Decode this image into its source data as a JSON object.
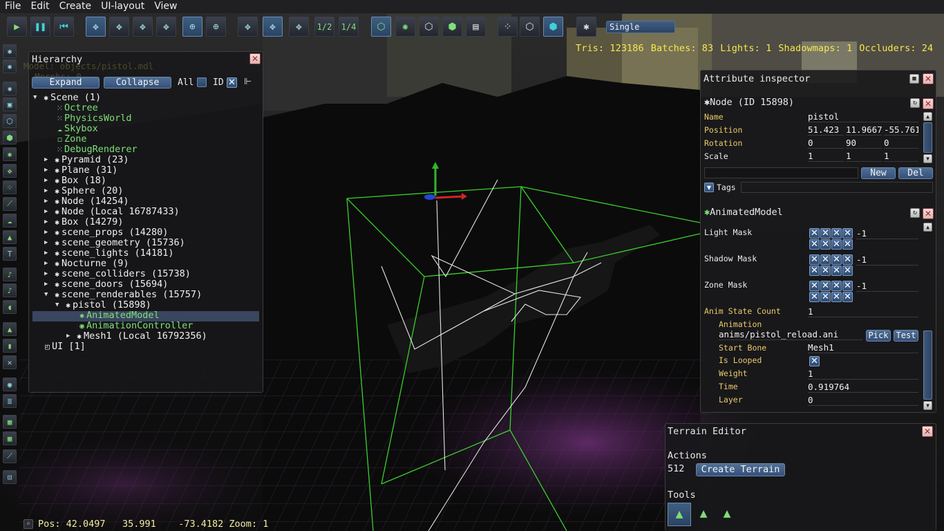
{
  "menubar": {
    "items": [
      "File",
      "Edit",
      "Create",
      "UI-layout",
      "View"
    ]
  },
  "toolbar": {
    "view_mode": "Single",
    "half_label": "1/2",
    "quarter_label": "1/4"
  },
  "stats": {
    "tris": "Tris: 123186",
    "batches": "Batches: 83",
    "lights": "Lights: 1",
    "shadowmaps": "Shadowmaps: 1",
    "occluders": "Occluders: 24"
  },
  "hierarchy": {
    "title": "Hierarchy",
    "expand_label": "Expand",
    "collapse_label": "Collapse",
    "all_label": "All",
    "id_label": "ID",
    "ghost": {
      "model": "Model: objects/pistol.mdl",
      "morphs": "Morphs: 0"
    },
    "nodes": [
      {
        "label": "Scene (1)",
        "expanded": true
      },
      {
        "label": "Octree"
      },
      {
        "label": "PhysicsWorld"
      },
      {
        "label": "Skybox"
      },
      {
        "label": "Zone"
      },
      {
        "label": "DebugRenderer"
      },
      {
        "label": "Pyramid (23)"
      },
      {
        "label": "Plane (31)"
      },
      {
        "label": "Box (18)"
      },
      {
        "label": "Sphere (20)"
      },
      {
        "label": "Node (14254)"
      },
      {
        "label": "Node (Local 16787433)"
      },
      {
        "label": "Box (14279)"
      },
      {
        "label": "scene_props (14280)"
      },
      {
        "label": "scene_geometry (15736)"
      },
      {
        "label": "scene_lights (14181)"
      },
      {
        "label": "Nocturne (9)"
      },
      {
        "label": "scene_colliders (15738)"
      },
      {
        "label": "scene_doors (15694)"
      },
      {
        "label": "scene_renderables (15757)"
      },
      {
        "label": "pistol (15898)"
      },
      {
        "label": "AnimatedModel"
      },
      {
        "label": "AnimationController"
      },
      {
        "label": "Mesh1 (Local 16792356)"
      },
      {
        "label": "UI [1]"
      }
    ]
  },
  "inspector": {
    "title": "Attribute inspector",
    "node_header": "Node (ID 15898)",
    "name_label": "Name",
    "name_value": "pistol",
    "position_label": "Position",
    "position": [
      "51.423",
      "11.9667",
      "-55.761"
    ],
    "rotation_label": "Rotation",
    "rotation": [
      "0",
      "90",
      "0"
    ],
    "scale_label": "Scale",
    "scale": [
      "1",
      "1",
      "1"
    ],
    "new_label": "New",
    "del_label": "Del",
    "tags_label": "Tags",
    "component_header": "AnimatedModel",
    "light_mask_label": "Light Mask",
    "light_mask_value": "-1",
    "shadow_mask_label": "Shadow Mask",
    "shadow_mask_value": "-1",
    "zone_mask_label": "Zone Mask",
    "zone_mask_value": "-1",
    "anim_state_count_label": "Anim State Count",
    "anim_state_count_value": "1",
    "animation_label": "Animation",
    "animation_value": "anims/pistol_reload.ani",
    "pick_label": "Pick",
    "test_label": "Test",
    "start_bone_label": "Start Bone",
    "start_bone_value": "Mesh1",
    "is_looped_label": "Is Looped",
    "weight_label": "Weight",
    "weight_value": "1",
    "time_label": "Time",
    "time_value": "0.919764",
    "layer_label": "Layer",
    "layer_value": "0"
  },
  "terrain": {
    "title": "Terrain Editor",
    "actions_label": "Actions",
    "size_value": "512",
    "create_label": "Create Terrain",
    "tools_label": "Tools"
  },
  "statusbar": {
    "pos_label": "Pos:",
    "x": "42.0497",
    "y": "35.991",
    "z": "-73.4182",
    "zoom": "Zoom: 1"
  }
}
